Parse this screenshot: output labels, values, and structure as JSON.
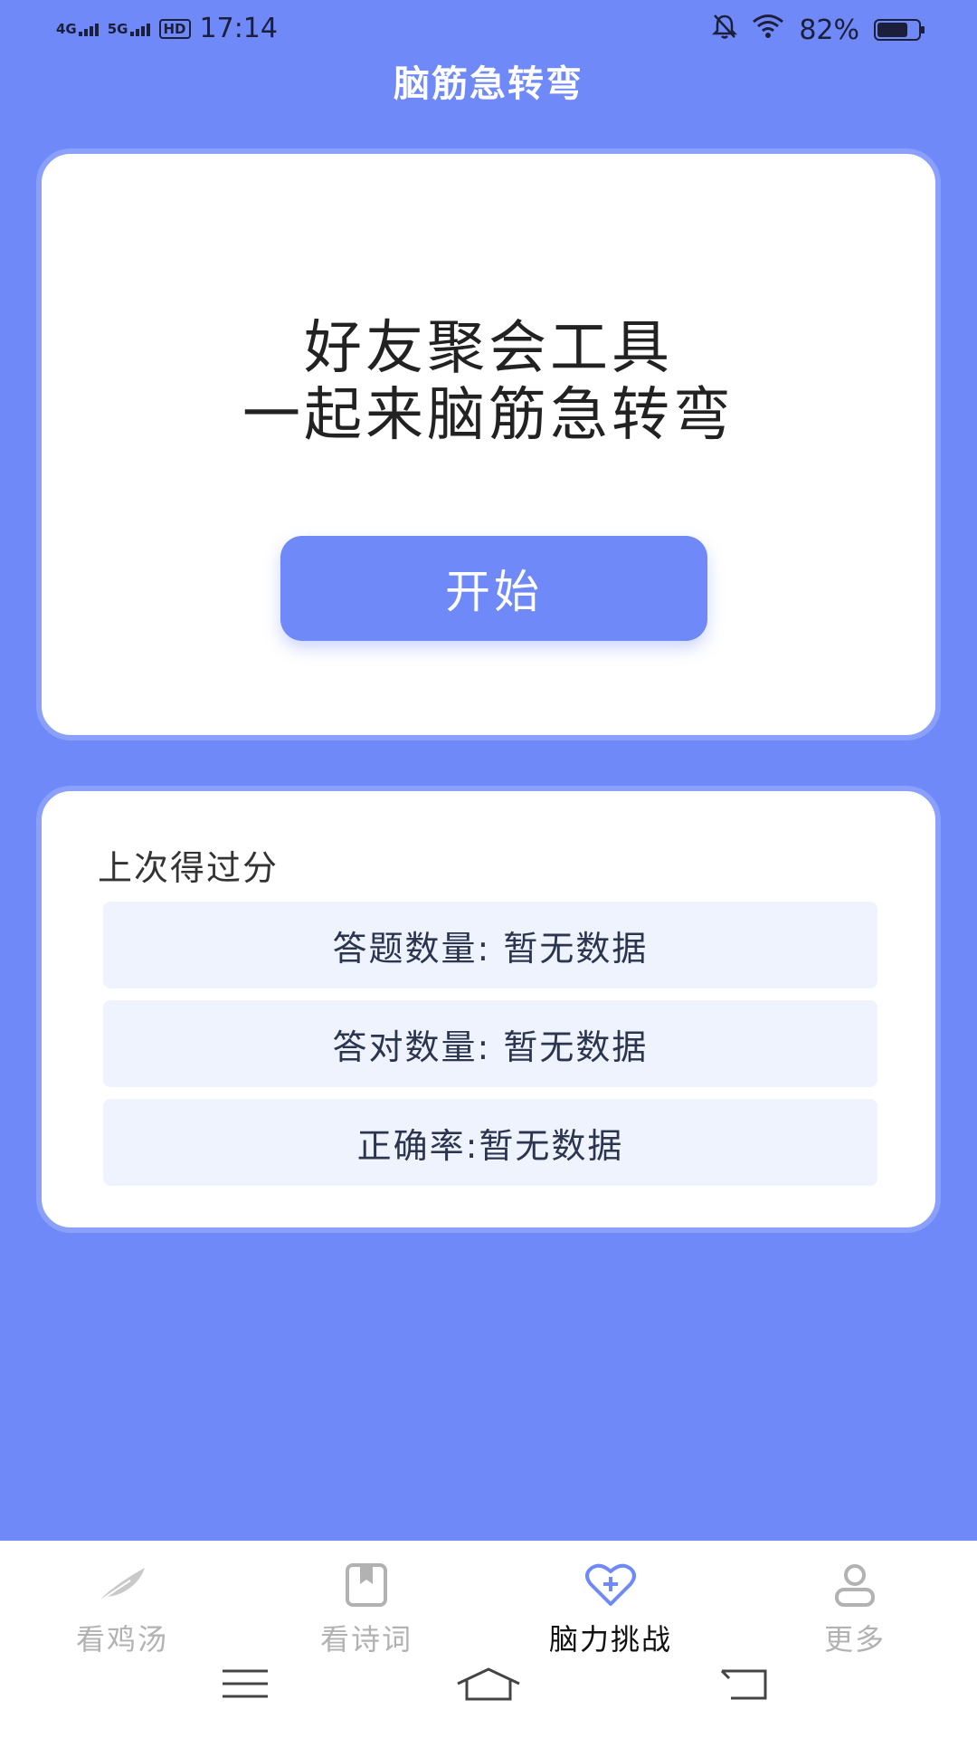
{
  "status_bar": {
    "network1": "4G",
    "network2": "5G",
    "hd_label": "HD",
    "time": "17:14",
    "battery_percent": "82%",
    "battery_level": 0.82
  },
  "header": {
    "title": "脑筋急转弯"
  },
  "hero": {
    "line1": "好友聚会工具",
    "line2": "一起来脑筋急转弯",
    "start_label": "开始"
  },
  "score": {
    "heading": "上次得过分",
    "rows": [
      "答题数量: 暂无数据",
      "答对数量: 暂无数据",
      "正确率:暂无数据"
    ]
  },
  "tabs": [
    {
      "label": "看鸡汤",
      "icon": "feather-icon",
      "active": false
    },
    {
      "label": "看诗词",
      "icon": "book-icon",
      "active": false
    },
    {
      "label": "脑力挑战",
      "icon": "heart-plus-icon",
      "active": true
    },
    {
      "label": "更多",
      "icon": "user-icon",
      "active": false
    }
  ],
  "colors": {
    "background": "#6f89f8",
    "card": "#ffffff",
    "row": "#eff3fe",
    "active_tab": "#111111",
    "inactive_tab": "#b2b2b2"
  }
}
